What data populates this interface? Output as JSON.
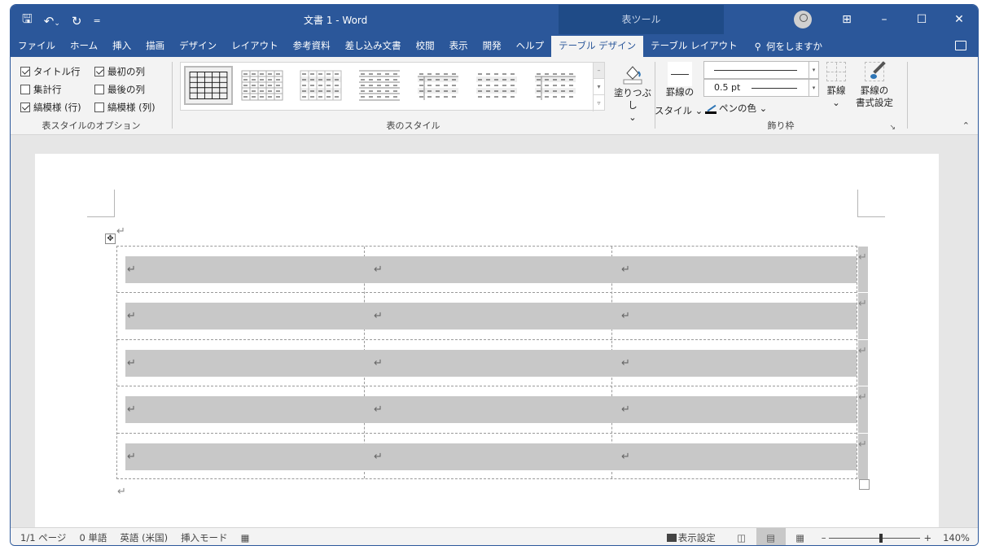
{
  "titlebar": {
    "title": "文書 1  -  Word",
    "context_tab_group": "表ツール",
    "qat": {
      "save_icon": "save-icon",
      "undo_icon": "undo-icon",
      "undo_more": "⌄",
      "redo_icon": "redo-icon",
      "customize": "="
    },
    "window_controls": {
      "ribbon_display": "ribbon-display-icon",
      "minimize": "–",
      "maximize": "☐",
      "close": "✕"
    }
  },
  "menu": {
    "tabs": [
      "ファイル",
      "ホーム",
      "挿入",
      "描画",
      "デザイン",
      "レイアウト",
      "参考資料",
      "差し込み文書",
      "校閲",
      "表示",
      "開発",
      "ヘルプ"
    ],
    "context_tabs": [
      "テーブル デザイン",
      "テーブル レイアウト"
    ],
    "active_tab": "テーブル デザイン",
    "tell_me": "何をしますか"
  },
  "ribbon": {
    "style_options": {
      "label": "表スタイルのオプション",
      "checkboxes": [
        {
          "label": "タイトル行",
          "checked": true
        },
        {
          "label": "最初の列",
          "checked": true
        },
        {
          "label": "集計行",
          "checked": false
        },
        {
          "label": "最後の列",
          "checked": false
        },
        {
          "label": "縞模様 (行)",
          "checked": true
        },
        {
          "label": "縞模様 (列)",
          "checked": false
        }
      ]
    },
    "table_styles": {
      "label": "表のスタイル",
      "gallery_count": 7,
      "selected_index": 0,
      "shading_label": "塗りつぶし",
      "more": "⌄"
    },
    "borders": {
      "label": "飾り枠",
      "border_styles_line1": "罫線の",
      "border_styles_line2": "スタイル ⌄",
      "pen_weight": "0.5 pt",
      "pen_color": "ペンの色 ⌄",
      "borders_label": "罫線",
      "borders_more": "⌄",
      "border_painter_line1": "罫線の",
      "border_painter_line2": "書式設定",
      "pen_color_value": "#000000"
    },
    "collapse": "^"
  },
  "document": {
    "paragraph_mark": "↵",
    "table": {
      "rows": 5,
      "cols": 3,
      "cells": [
        [
          "↵",
          "↵",
          "↵"
        ],
        [
          "↵",
          "↵",
          "↵"
        ],
        [
          "↵",
          "↵",
          "↵"
        ],
        [
          "↵",
          "↵",
          "↵"
        ],
        [
          "↵",
          "↵",
          "↵"
        ]
      ],
      "row_end": "↵"
    },
    "shading_color": "#c8c8c8"
  },
  "status": {
    "page": "1/1 ページ",
    "words": "0 単語",
    "language": "英語 (米国)",
    "mode": "挿入モード",
    "display_settings": "表示設定",
    "zoom_minus": "–",
    "zoom_plus": "+",
    "zoom": "140%",
    "active_view": "print-layout"
  },
  "colors": {
    "brand": "#2b579a",
    "context_tab_bg": "#1f4b87"
  }
}
